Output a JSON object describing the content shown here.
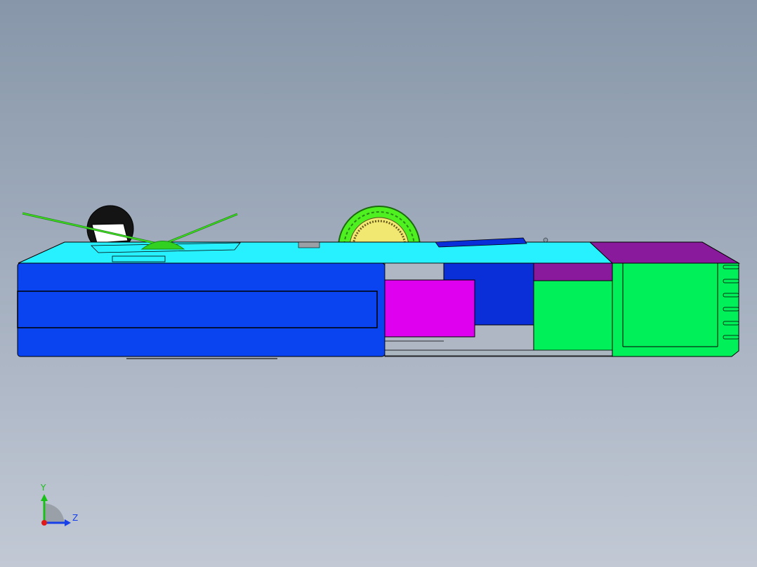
{
  "viewport": {
    "background_top": "#8797a9",
    "background_bottom": "#c2c9d5"
  },
  "model": {
    "colors": {
      "blue_panel": "#0a43f0",
      "cyan_top": "#27f0ff",
      "green_block": "#00f05a",
      "magenta_block": "#e000f0",
      "purple_block": "#8a1a9c",
      "dark_blue": "#0a2fd8",
      "wheel_yellow": "#f0e870",
      "wheel_green": "#4ef020",
      "tire_black": "#141414"
    }
  },
  "triad": {
    "y_label": "Y",
    "z_label": "Z",
    "y_color": "#18c018",
    "z_color": "#1840e8",
    "origin_color": "#e01818"
  }
}
